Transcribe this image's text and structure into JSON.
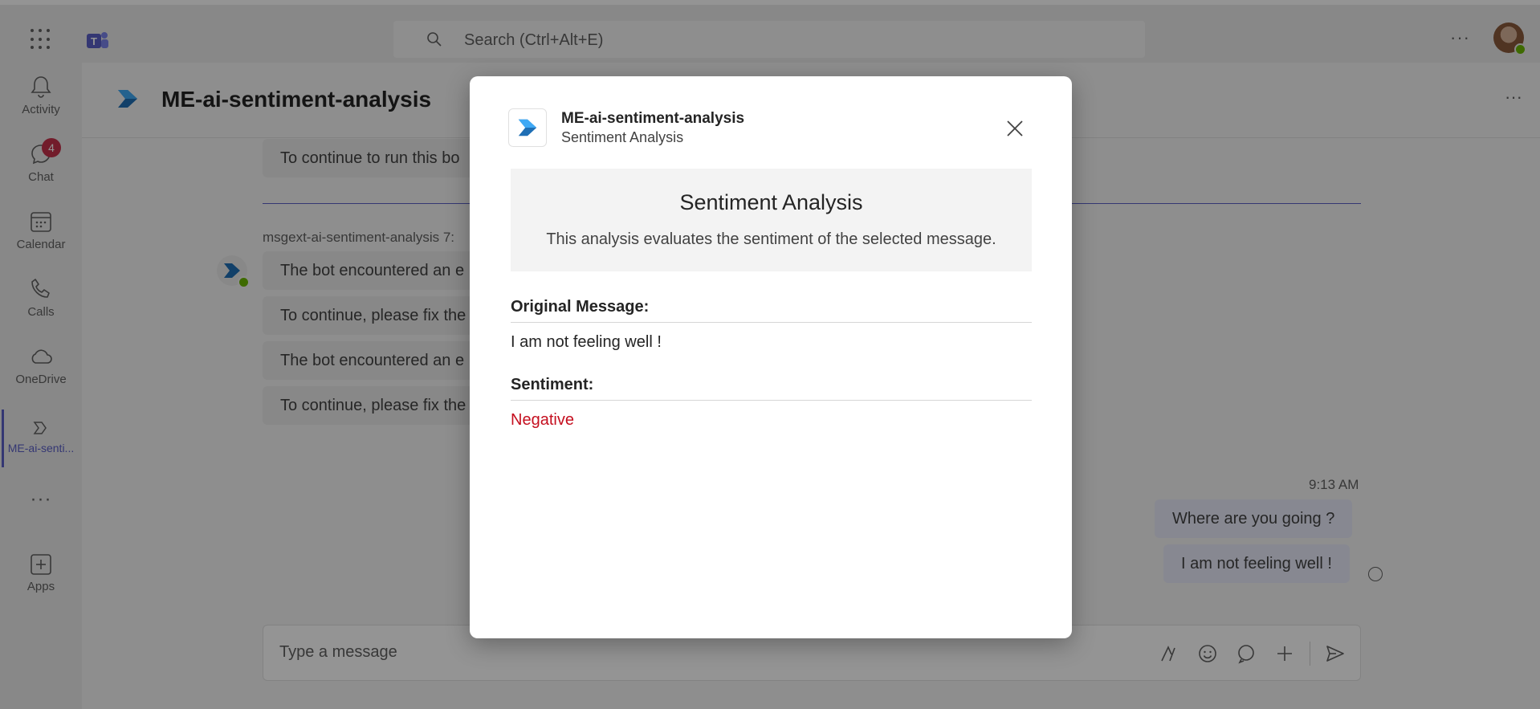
{
  "topbar": {
    "search_placeholder": "Search (Ctrl+Alt+E)"
  },
  "rail": {
    "items": [
      {
        "label": "Activity"
      },
      {
        "label": "Chat",
        "badge": "4"
      },
      {
        "label": "Calendar"
      },
      {
        "label": "Calls"
      },
      {
        "label": "OneDrive"
      },
      {
        "label": "ME-ai-senti..."
      },
      {
        "label": "Apps"
      }
    ]
  },
  "chat": {
    "title": "ME-ai-sentiment-analysis",
    "messages": [
      "To continue to run this bo",
      "The bot encountered an e",
      "To continue, please fix the",
      "The bot encountered an e",
      "To continue, please fix the"
    ],
    "sender": "msgext-ai-sentiment-analysis  7:",
    "time": "9:13 AM",
    "my_messages": [
      "Where are you going ?",
      "I am not feeling well !"
    ],
    "composer_placeholder": "Type a message"
  },
  "modal": {
    "app_name": "ME-ai-sentiment-analysis",
    "app_subtitle": "Sentiment Analysis",
    "card_title": "Sentiment Analysis",
    "card_description": "This analysis evaluates the sentiment of the selected message.",
    "original_label": "Original Message:",
    "original_value": "I am not feeling well !",
    "sentiment_label": "Sentiment:",
    "sentiment_value": "Negative",
    "sentiment_color": "#c50f1f"
  }
}
